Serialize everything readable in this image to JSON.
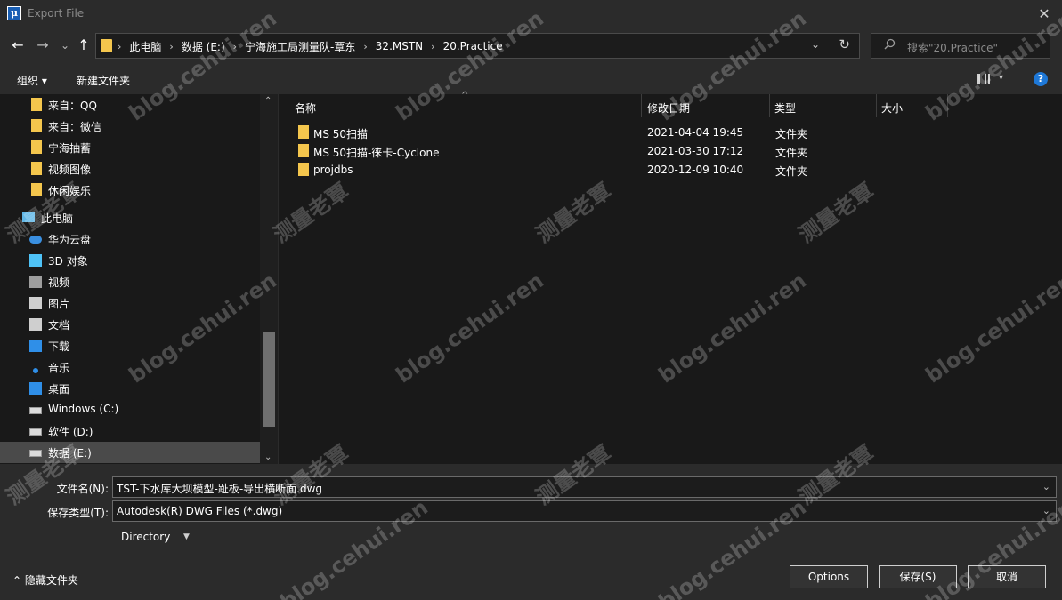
{
  "window": {
    "app_icon": "μ",
    "title": "Export File",
    "close": "✕"
  },
  "nav": {
    "back": "←",
    "forward": "→",
    "recent": "⌄",
    "up": "↑"
  },
  "address": {
    "crumbs": [
      "此电脑",
      "数据 (E:)",
      "宁海施工局测量队-覃东",
      "32.MSTN",
      "20.Practice"
    ],
    "separator": "›",
    "dropdown": "⌄",
    "refresh": "↻"
  },
  "search": {
    "icon": "search-icon",
    "placeholder": "搜索\"20.Practice\""
  },
  "toolbar": {
    "organize": "组织 ▾",
    "new_folder": "新建文件夹",
    "view_dropdown": "▾",
    "help": "?"
  },
  "sidebar": {
    "items": [
      {
        "label": "来自：QQ",
        "icon": "folder-icon",
        "color": "#f4c64d"
      },
      {
        "label": "来自：微信",
        "icon": "folder-icon",
        "color": "#f4c64d"
      },
      {
        "label": "宁海抽蓄",
        "icon": "folder-icon",
        "color": "#f4c64d"
      },
      {
        "label": "视频图像",
        "icon": "folder-icon",
        "color": "#f4c64d"
      },
      {
        "label": "休闲娱乐",
        "icon": "folder-icon",
        "color": "#f4c64d"
      },
      {
        "label": "此电脑",
        "icon": "computer-icon",
        "color": "#5fb6e6"
      },
      {
        "label": "华为云盘",
        "icon": "cloud-icon",
        "color": "#3a8fe0"
      },
      {
        "label": "3D 对象",
        "icon": "cube-icon",
        "color": "#4fc3f7"
      },
      {
        "label": "视频",
        "icon": "video-icon",
        "color": "#9e9e9e"
      },
      {
        "label": "图片",
        "icon": "picture-icon",
        "color": "#cfcfcf"
      },
      {
        "label": "文档",
        "icon": "document-icon",
        "color": "#cfcfcf"
      },
      {
        "label": "下载",
        "icon": "download-icon",
        "color": "#2f8fe8"
      },
      {
        "label": "音乐",
        "icon": "music-icon",
        "color": "#2f8fe8"
      },
      {
        "label": "桌面",
        "icon": "desktop-icon",
        "color": "#2f8fe8"
      },
      {
        "label": "Windows (C:)",
        "icon": "drive-icon",
        "color": "#cfcfcf"
      },
      {
        "label": "软件 (D:)",
        "icon": "drive-icon",
        "color": "#cfcfcf"
      },
      {
        "label": "数据 (E:)",
        "icon": "drive-icon",
        "color": "#cfcfcf",
        "selected": true
      }
    ],
    "scroll_up": "⌃",
    "scroll_down": "⌄"
  },
  "columns": {
    "name": "名称",
    "modified": "修改日期",
    "type": "类型",
    "size": "大小",
    "sort_indicator": "^"
  },
  "files": [
    {
      "name": "MS 50扫描",
      "modified": "2021-04-04 19:45",
      "type": "文件夹"
    },
    {
      "name": "MS 50扫描-徕卡-Cyclone",
      "modified": "2021-03-30 17:12",
      "type": "文件夹"
    },
    {
      "name": "projdbs",
      "modified": "2020-12-09 10:40",
      "type": "文件夹"
    }
  ],
  "form": {
    "filename_label": "文件名(N):",
    "filename_value": "TST-下水库大坝模型-趾板-导出横断面.dwg",
    "filetype_label": "保存类型(T):",
    "filetype_value": "Autodesk(R) DWG Files (*.dwg)",
    "combo_dropdown": "⌄",
    "directory": "Directory",
    "directory_dropdown": "▼",
    "hide_folders": "⌃ 隐藏文件夹"
  },
  "buttons": {
    "options": "Options",
    "save": "保存(S)",
    "cancel": "取消"
  },
  "watermarks": {
    "blog": "blog.cehui.ren",
    "cn": "测量老覃"
  }
}
